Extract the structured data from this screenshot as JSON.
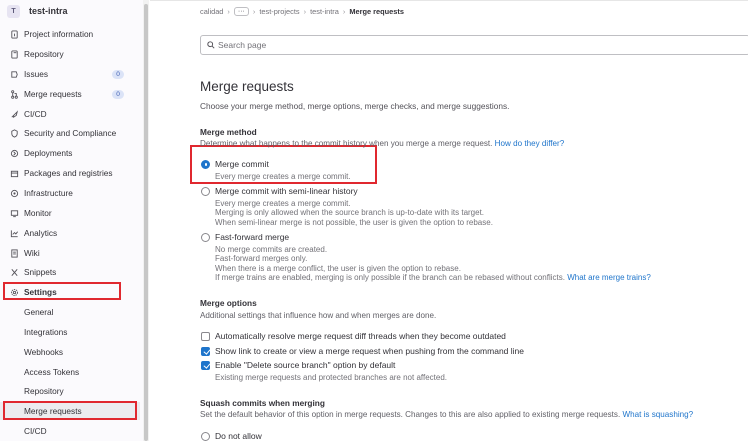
{
  "project": {
    "avatar_letter": "T",
    "name": "test-intra"
  },
  "sidebar": {
    "items": [
      {
        "label": "Project information",
        "icon": "info-icon"
      },
      {
        "label": "Repository",
        "icon": "book-icon"
      },
      {
        "label": "Issues",
        "icon": "issues-icon",
        "badge": "0"
      },
      {
        "label": "Merge requests",
        "icon": "merge-request-icon",
        "badge": "0"
      },
      {
        "label": "CI/CD",
        "icon": "rocket-icon"
      },
      {
        "label": "Security and Compliance",
        "icon": "shield-icon"
      },
      {
        "label": "Deployments",
        "icon": "deployments-icon"
      },
      {
        "label": "Packages and registries",
        "icon": "package-icon"
      },
      {
        "label": "Infrastructure",
        "icon": "infrastructure-icon"
      },
      {
        "label": "Monitor",
        "icon": "monitor-icon"
      },
      {
        "label": "Analytics",
        "icon": "chart-icon"
      },
      {
        "label": "Wiki",
        "icon": "wiki-icon"
      },
      {
        "label": "Snippets",
        "icon": "snippet-icon"
      },
      {
        "label": "Settings",
        "icon": "settings-icon"
      }
    ],
    "settings_sub": [
      "General",
      "Integrations",
      "Webhooks",
      "Access Tokens",
      "Repository",
      "Merge requests",
      "CI/CD"
    ]
  },
  "breadcrumb": {
    "group": "calidad",
    "ellipsis": "···",
    "subgroup": "test-projects",
    "project": "test-intra",
    "current": "Merge requests"
  },
  "search": {
    "placeholder": "Search page"
  },
  "page": {
    "title": "Merge requests",
    "description": "Choose your merge method, merge options, merge checks, and merge suggestions."
  },
  "merge_method": {
    "title": "Merge method",
    "help": "Determine what happens to the commit history when you merge a merge request.",
    "help_link": "How do they differ?",
    "options": [
      {
        "label": "Merge commit",
        "selected": true,
        "lines": [
          "Every merge creates a merge commit."
        ]
      },
      {
        "label": "Merge commit with semi-linear history",
        "selected": false,
        "lines": [
          "Every merge creates a merge commit.",
          "Merging is only allowed when the source branch is up-to-date with its target.",
          "When semi-linear merge is not possible, the user is given the option to rebase."
        ]
      },
      {
        "label": "Fast-forward merge",
        "selected": false,
        "lines": [
          "No merge commits are created.",
          "Fast-forward merges only.",
          "When there is a merge conflict, the user is given the option to rebase.",
          "If merge trains are enabled, merging is only possible if the branch can be rebased without conflicts."
        ],
        "link": "What are merge trains?"
      }
    ]
  },
  "merge_options": {
    "title": "Merge options",
    "help": "Additional settings that influence how and when merges are done.",
    "checkboxes": [
      {
        "label": "Automatically resolve merge request diff threads when they become outdated",
        "checked": false
      },
      {
        "label": "Show link to create or view a merge request when pushing from the command line",
        "checked": true
      },
      {
        "label": "Enable \"Delete source branch\" option by default",
        "checked": true,
        "help": "Existing merge requests and protected branches are not affected."
      }
    ]
  },
  "squash": {
    "title": "Squash commits when merging",
    "help": "Set the default behavior of this option in merge requests. Changes to this are also applied to existing merge requests.",
    "help_link": "What is squashing?",
    "options": [
      {
        "label": "Do not allow",
        "selected": false
      }
    ]
  },
  "colors": {
    "highlight": "#e0282f",
    "accent": "#1f75cb"
  }
}
